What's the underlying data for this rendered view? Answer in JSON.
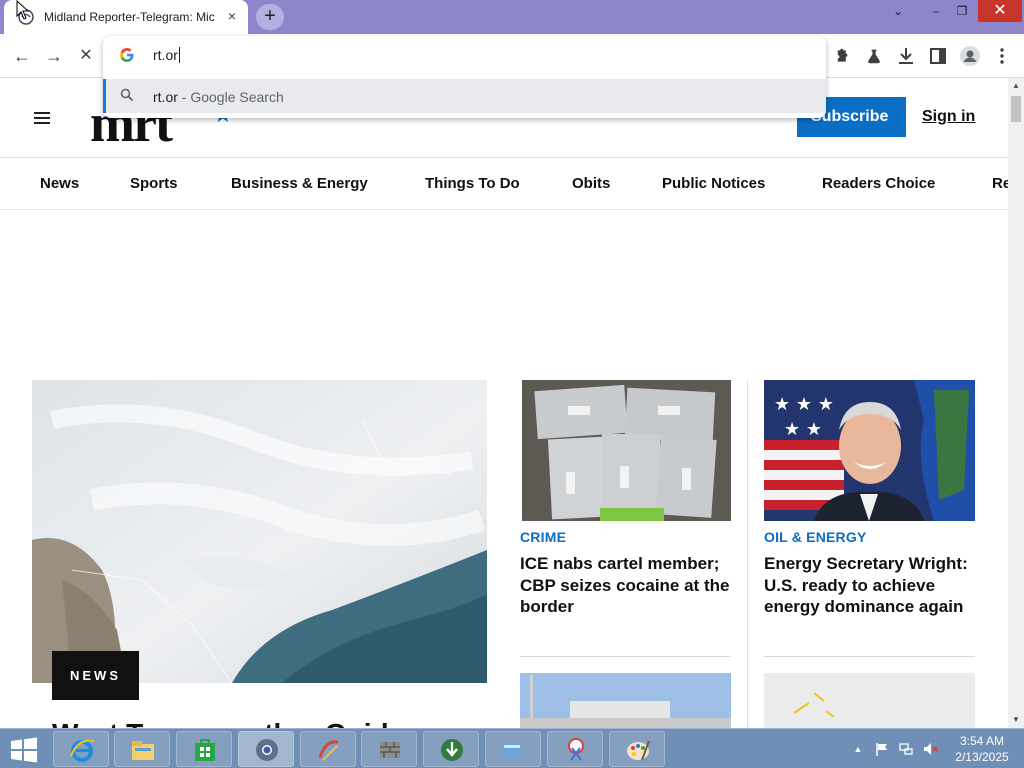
{
  "browser": {
    "tab": {
      "title": "Midland Reporter-Telegram: Mic",
      "close_icon": "×"
    },
    "new_tab_icon": "+",
    "window_controls": {
      "chevron": "⌄",
      "minimize": "–",
      "restore": "❐",
      "close": "✕"
    },
    "toolbar": {
      "back_icon": "←",
      "forward_icon": "→",
      "stop_icon": "✕"
    },
    "omnibox": {
      "typed_text": "rt.or",
      "suggestion": {
        "query": "rt.or",
        "suffix": " - Google Search"
      }
    }
  },
  "site": {
    "logo_text": "mrt",
    "logo_star": "★",
    "subscribe_label": "Subscribe",
    "signin_label": "Sign in",
    "nav": [
      "News",
      "Sports",
      "Business & Energy",
      "Things To Do",
      "Obits",
      "Public Notices",
      "Readers Choice",
      "Re"
    ],
    "feature": {
      "badge": "NEWS",
      "headline_peek": "West Texas weather Guide"
    },
    "stories": [
      {
        "kicker": "CRIME",
        "headline": "ICE nabs cartel member; CBP seizes cocaine at the border"
      },
      {
        "kicker": "OIL & ENERGY",
        "headline": "Energy Secretary Wright: U.S. ready to achieve energy dominance again"
      }
    ]
  },
  "taskbar": {
    "clock_time": "3:54 AM",
    "clock_date": "2/13/2025",
    "tray_chevron": "▲"
  },
  "colors": {
    "tabstrip": "#8e86cc",
    "accent_blue": "#0a6ec4",
    "taskbar": "#6f8fb6",
    "close_red": "#c7352b"
  }
}
